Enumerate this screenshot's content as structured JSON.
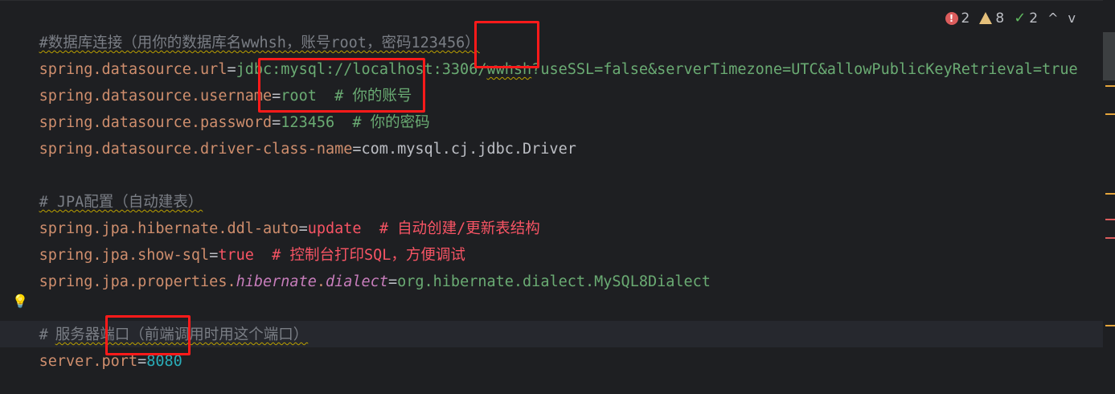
{
  "status_bar": {
    "errors": "2",
    "warnings": "8",
    "ok": "2",
    "error_icon": "error-icon",
    "warning_icon": "warning-icon",
    "check_icon": "check-icon",
    "up_icon": "chevron-up-icon",
    "down_icon": "chevron-down-icon",
    "up_glyph": "^",
    "down_glyph": "v"
  },
  "lines": {
    "l1": {
      "comment": "#数据库连接（用你的数据库名wwhsh，账号root，密码123456）"
    },
    "l2": {
      "key": "spring.datasource.url",
      "eq": "=",
      "val_a": "jdbc:mysql://localhost:3306/",
      "val_b": "wwhsh",
      "val_c": "?useSSL=false&serverTimezone=UTC&allowPublicKeyRetrieval=true"
    },
    "l3": {
      "key": "spring.datasource.username",
      "eq": "=",
      "val": "root",
      "comment": "  # 你的账号"
    },
    "l4": {
      "key": "spring.datasource.password",
      "eq": "=",
      "val": "123456",
      "comment": "  # 你的密码"
    },
    "l5": {
      "key": "spring.datasource.driver-class-name",
      "eq": "=",
      "val": "com.mysql.cj.jdbc.Driver"
    },
    "l7": {
      "comment": "# JPA配置（自动建表）"
    },
    "l8": {
      "key": "spring.jpa.hibernate.ddl-auto",
      "eq": "=",
      "val": "update",
      "comment": "  # 自动创建/更新表结构"
    },
    "l9": {
      "key": "spring.jpa.show-sql",
      "eq": "=",
      "val": "true",
      "comment": "  # 控制台打印SQL，方便调试"
    },
    "l10": {
      "key_a": "spring.jpa.properties.",
      "key_b": "hibernate",
      "key_c": ".",
      "key_d": "dialect",
      "eq": "=",
      "val": "org.hibernate.dialect.MySQL8Dialect"
    },
    "l12": {
      "comment_a": "#",
      "comment_b": "服务器端口（前端调用时用这个端口）"
    },
    "l13": {
      "key": "server.port",
      "eq": "=",
      "val": "8080"
    }
  },
  "colors": {
    "background": "#1e1f22",
    "annotation_box": "#ff1a1a",
    "key": "#cf8e6d",
    "value_green": "#6aab73",
    "value_red": "#f75464",
    "number": "#2aacb8"
  },
  "gutter": {
    "intention_icon": "lightbulb-icon",
    "intention_glyph": "💡"
  }
}
